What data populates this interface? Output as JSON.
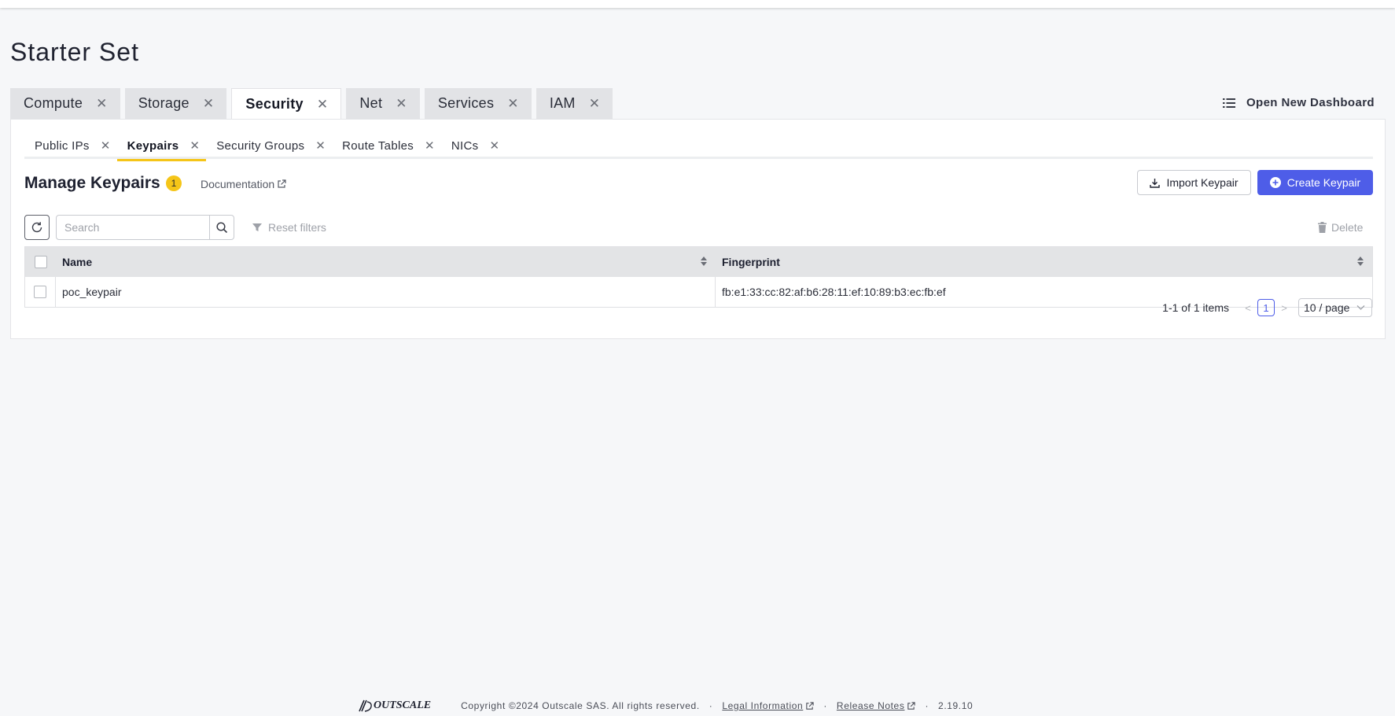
{
  "page": {
    "title": "Starter Set"
  },
  "dashboard_tabs": [
    {
      "label": "Compute",
      "active": false
    },
    {
      "label": "Storage",
      "active": false
    },
    {
      "label": "Security",
      "active": true
    },
    {
      "label": "Net",
      "active": false
    },
    {
      "label": "Services",
      "active": false
    },
    {
      "label": "IAM",
      "active": false
    }
  ],
  "open_dashboard": {
    "label": "Open New Dashboard",
    "icon": "list-icon"
  },
  "sub_tabs": [
    {
      "label": "Public IPs",
      "active": false
    },
    {
      "label": "Keypairs",
      "active": true
    },
    {
      "label": "Security Groups",
      "active": false
    },
    {
      "label": "Route Tables",
      "active": false
    },
    {
      "label": "NICs",
      "active": false
    }
  ],
  "manage": {
    "title": "Manage Keypairs",
    "count": "1",
    "doc_label": "Documentation",
    "import_label": "Import Keypair",
    "create_label": "Create Keypair"
  },
  "toolbar": {
    "search_placeholder": "Search",
    "reset_label": "Reset filters",
    "delete_label": "Delete"
  },
  "table": {
    "columns": [
      "Name",
      "Fingerprint"
    ],
    "rows": [
      {
        "name": "poc_keypair",
        "fingerprint": "fb:e1:33:cc:82:af:b6:28:11:ef:10:89:b3:ec:fb:ef"
      }
    ]
  },
  "pagination": {
    "total_text": "1-1 of 1 items",
    "current_page": "1",
    "page_size": "10 / page"
  },
  "footer": {
    "brand": "OUTSCALE",
    "copyright": "Copyright ©2024 Outscale SAS. All rights reserved.",
    "legal": "Legal Information",
    "release_notes": "Release Notes",
    "version": "2.19.10",
    "separator": "·"
  },
  "colors": {
    "accent": "#4e5de8",
    "tab_underline": "#f5c518",
    "badge": "#f5c518",
    "background": "#f6f7f9"
  }
}
